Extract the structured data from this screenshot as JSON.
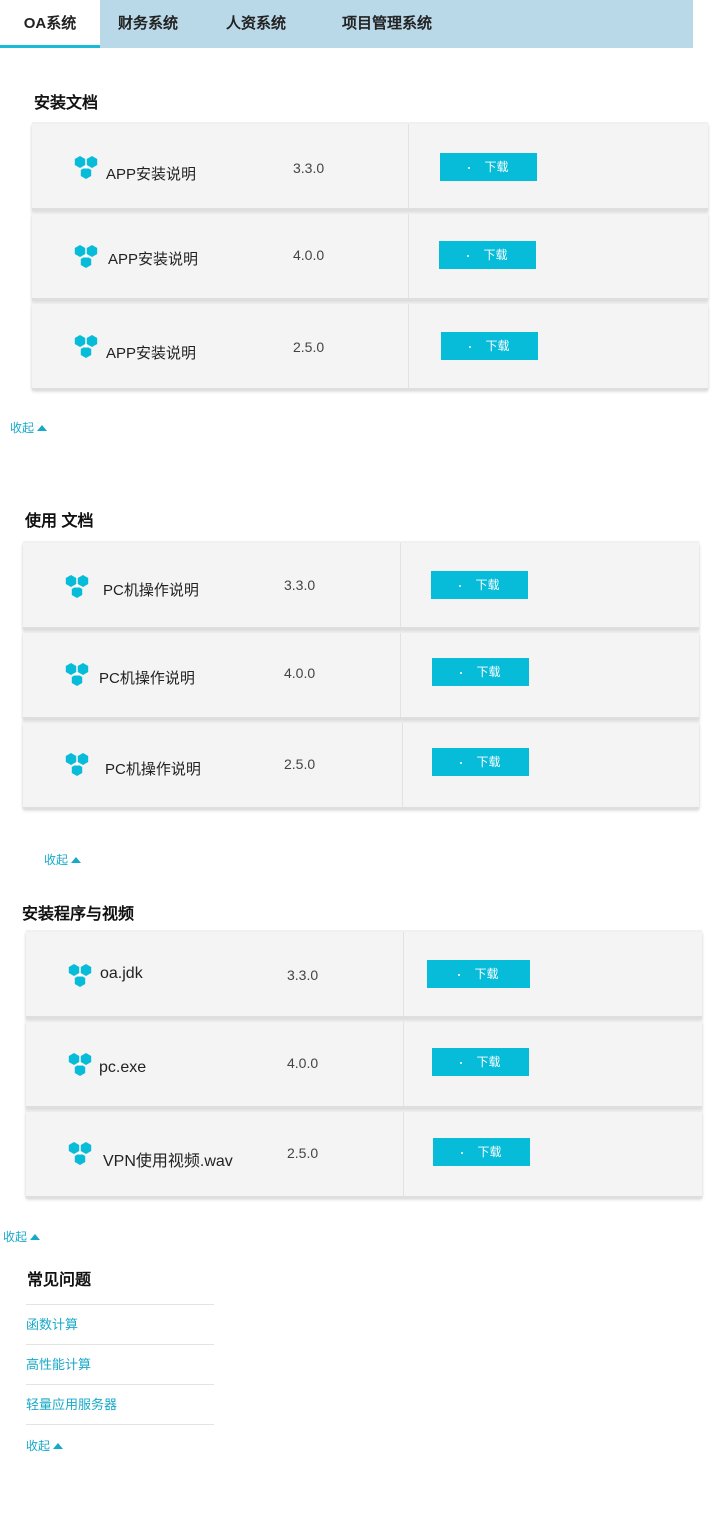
{
  "tabs": [
    {
      "label": "OA系统"
    },
    {
      "label": "财务系统"
    },
    {
      "label": "人资系统"
    },
    {
      "label": "项目管理系统"
    }
  ],
  "sections": [
    {
      "title": "安装文档",
      "rows": [
        {
          "name": "APP安装说明",
          "version": "3.3.0"
        },
        {
          "name": "APP安装说明",
          "version": "4.0.0"
        },
        {
          "name": "APP安装说明",
          "version": "2.5.0"
        }
      ]
    },
    {
      "title": "使用 文档",
      "rows": [
        {
          "name": "PC机操作说明",
          "version": "3.3.0"
        },
        {
          "name": "PC机操作说明",
          "version": "4.0.0"
        },
        {
          "name": "PC机操作说明",
          "version": "2.5.0"
        }
      ]
    },
    {
      "title": "安装程序与视频",
      "rows": [
        {
          "name": "oa.jdk",
          "version": "3.3.0"
        },
        {
          "name": "pc.exe",
          "version": "4.0.0"
        },
        {
          "name": "VPN使用视频.wav",
          "version": "2.5.0"
        }
      ]
    }
  ],
  "download_label": "下载",
  "collapse_label": "收起",
  "faq": {
    "title": "常见问题",
    "items": [
      "函数计算",
      "高性能计算",
      "轻量应用服务器"
    ]
  },
  "colors": {
    "accent": "#06bcd9",
    "tabbar": "#b9d8e8",
    "link": "#17a9c9"
  },
  "icons": {
    "row_logo": "hexagon-cluster-icon",
    "collapse": "caret-up-icon"
  }
}
